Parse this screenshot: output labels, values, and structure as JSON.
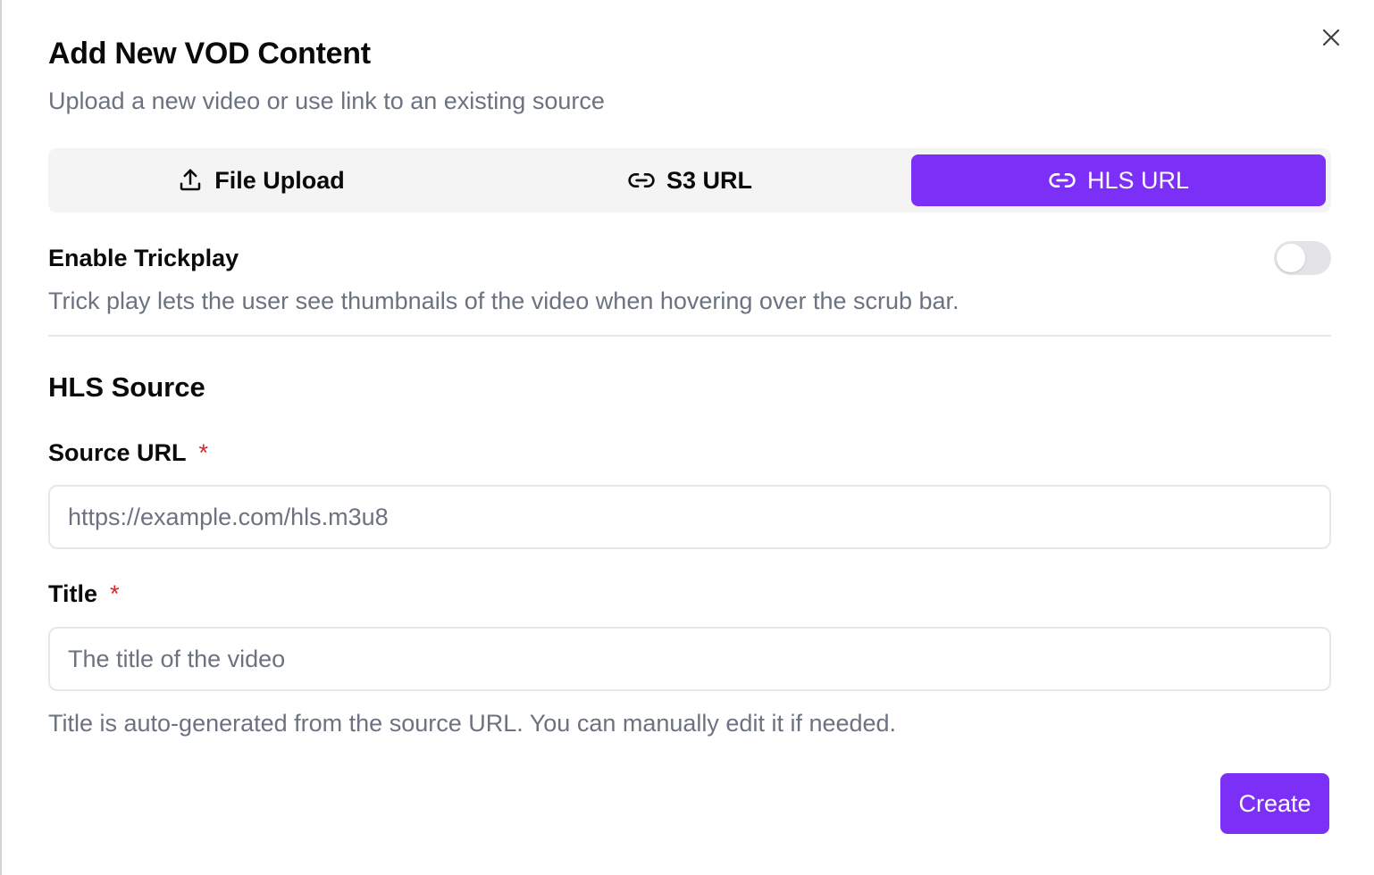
{
  "dialog": {
    "title": "Add New VOD Content",
    "subtitle": "Upload a new video or use link to an existing source"
  },
  "tabs": [
    {
      "label": "File Upload",
      "icon": "upload-icon",
      "active": false
    },
    {
      "label": "S3 URL",
      "icon": "link-icon",
      "active": false
    },
    {
      "label": "HLS URL",
      "icon": "link-icon",
      "active": true
    }
  ],
  "trickplay": {
    "label": "Enable Trickplay",
    "description": "Trick play lets the user see thumbnails of the video when hovering over the scrub bar.",
    "enabled": false
  },
  "section": {
    "title": "HLS Source"
  },
  "fields": {
    "source_url": {
      "label": "Source URL",
      "required_mark": "*",
      "value": "",
      "placeholder": "https://example.com/hls.m3u8"
    },
    "title": {
      "label": "Title",
      "required_mark": "*",
      "value": "",
      "placeholder": "The title of the video",
      "helper": "Title is auto-generated from the source URL. You can manually edit it if needed."
    }
  },
  "actions": {
    "create_label": "Create"
  },
  "colors": {
    "accent": "#7b2ff7",
    "required": "#dc2626",
    "muted_text": "#6b7280",
    "tab_bg": "#f4f4f5"
  }
}
